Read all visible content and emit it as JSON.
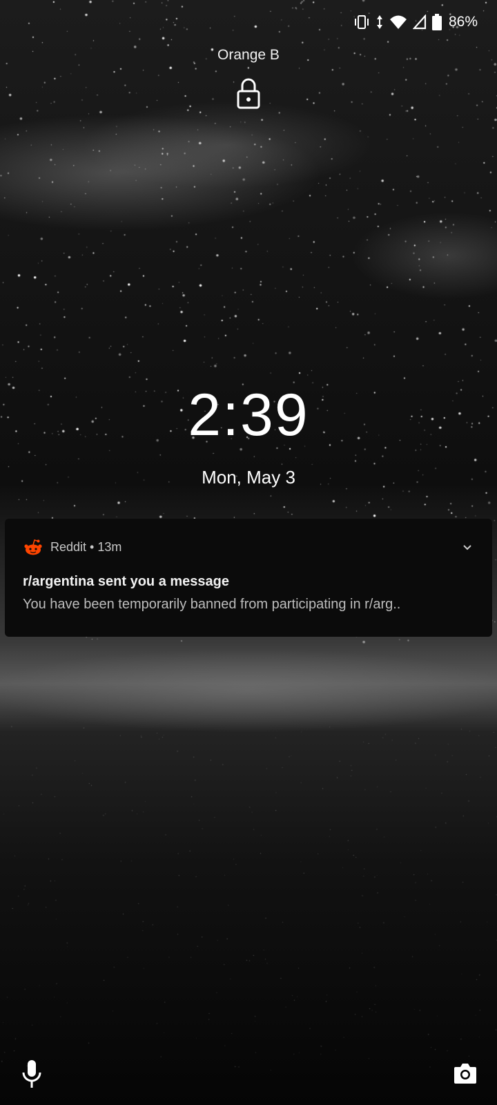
{
  "status_bar": {
    "icons": [
      "vibrate-icon",
      "data-arrows-icon",
      "wifi-icon",
      "signal-icon",
      "battery-icon"
    ],
    "battery_percent": "86%"
  },
  "lockscreen": {
    "carrier": "Orange B",
    "time": "2:39",
    "date": "Mon, May 3"
  },
  "notification": {
    "app_icon": "reddit-icon",
    "app_name": "Reddit",
    "separator": "•",
    "age": "13m",
    "title": "r/argentina sent you a message",
    "body": "You have been temporarily banned from participating in r/arg..",
    "accent_color": "#ff4500"
  },
  "shortcuts": {
    "left_icon": "mic-icon",
    "right_icon": "camera-icon"
  }
}
